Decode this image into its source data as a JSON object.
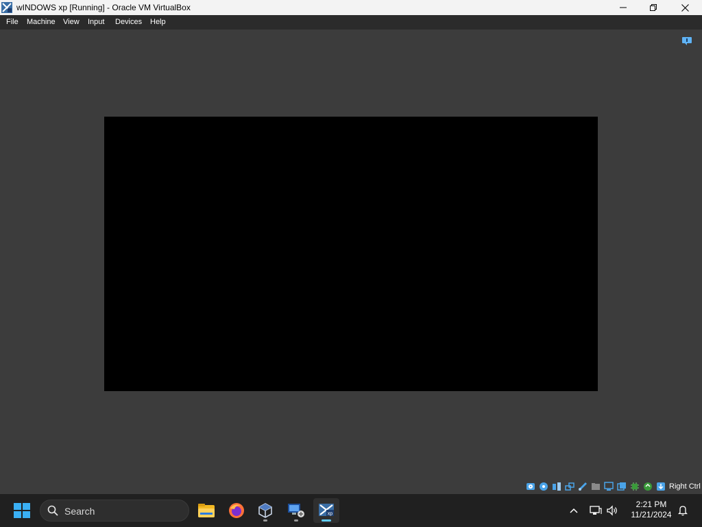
{
  "window": {
    "title": "wINDOWS xp [Running] - Oracle VM VirtualBox",
    "icon": "virtualbox-vm-icon"
  },
  "window_controls": [
    "minimize-icon",
    "restore-icon",
    "close-icon"
  ],
  "menu": {
    "items": [
      {
        "label": "File"
      },
      {
        "label": "Machine"
      },
      {
        "label": "View"
      },
      {
        "label": "Input"
      },
      {
        "label": "Devices"
      },
      {
        "label": "Help"
      }
    ]
  },
  "status_bar": {
    "icons": [
      "hard-disk-icon",
      "optical-drive-icon",
      "audio-icon",
      "network-icon",
      "usb-icon",
      "shared-folders-icon",
      "display-icon",
      "recording-icon",
      "cpu-icon",
      "mouse-integration-icon",
      "keyboard-icon"
    ],
    "host_key": "Right Ctrl"
  },
  "taskbar": {
    "search_placeholder": "Search",
    "apps": [
      {
        "name": "file-explorer-icon",
        "active": false,
        "running": false
      },
      {
        "name": "firefox-icon",
        "active": false,
        "running": false
      },
      {
        "name": "virtualbox-icon",
        "active": false,
        "running": true
      },
      {
        "name": "remote-desktop-icon",
        "active": false,
        "running": true
      },
      {
        "name": "windows-xp-vm-icon",
        "active": true,
        "running": true
      }
    ],
    "clock": {
      "time": "2:21 PM",
      "date": "11/21/2024"
    }
  },
  "colors": {
    "vm_background": "#3c3c3c",
    "vm_screen": "#000000",
    "taskbar": "#202020",
    "accent": "#60cdff"
  }
}
